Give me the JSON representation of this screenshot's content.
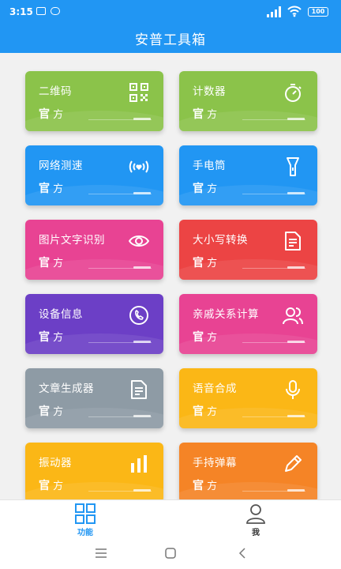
{
  "status_bar": {
    "time": "3:15",
    "signal": "HD",
    "battery": "100"
  },
  "header": {
    "title": "安普工具箱",
    "color": "#2196f3"
  },
  "tools": [
    {
      "name": "二维码",
      "tag_bold": "官",
      "tag_rest": "方",
      "color": "#8bc34a",
      "icon": "qr-code-icon"
    },
    {
      "name": "计数器",
      "tag_bold": "官",
      "tag_rest": "方",
      "color": "#8bc34a",
      "icon": "stopwatch-icon"
    },
    {
      "name": "网络测速",
      "tag_bold": "官",
      "tag_rest": "方",
      "color": "#2196f3",
      "icon": "network-signal-icon"
    },
    {
      "name": "手电筒",
      "tag_bold": "官",
      "tag_rest": "方",
      "color": "#2196f3",
      "icon": "flashlight-icon"
    },
    {
      "name": "图片文字识别",
      "tag_bold": "官",
      "tag_rest": "方",
      "color": "#e84393",
      "icon": "eye-icon"
    },
    {
      "name": "大小写转换",
      "tag_bold": "官",
      "tag_rest": "方",
      "color": "#ec4444",
      "icon": "document-icon"
    },
    {
      "name": "设备信息",
      "tag_bold": "官",
      "tag_rest": "方",
      "color": "#6c3fc6",
      "icon": "phone-call-icon"
    },
    {
      "name": "亲戚关系计算",
      "tag_bold": "官",
      "tag_rest": "方",
      "color": "#e84393",
      "icon": "users-icon"
    },
    {
      "name": "文章生成器",
      "tag_bold": "官",
      "tag_rest": "方",
      "color": "#8e9ba5",
      "icon": "article-icon"
    },
    {
      "name": "语音合成",
      "tag_bold": "官",
      "tag_rest": "方",
      "color": "#fbb716",
      "icon": "microphone-icon"
    },
    {
      "name": "振动器",
      "tag_bold": "官",
      "tag_rest": "方",
      "color": "#fbb716",
      "icon": "bar-chart-icon"
    },
    {
      "name": "手持弹幕",
      "tag_bold": "官",
      "tag_rest": "方",
      "color": "#f58426",
      "icon": "pencil-icon"
    }
  ],
  "bottom_nav": [
    {
      "label": "功能",
      "icon": "grid-icon",
      "active": true,
      "color": "#2196f3"
    },
    {
      "label": "我",
      "icon": "person-icon",
      "active": false,
      "color": "#333333"
    }
  ],
  "system_nav": [
    {
      "icon": "menu-icon"
    },
    {
      "icon": "home-icon"
    },
    {
      "icon": "back-icon"
    }
  ]
}
